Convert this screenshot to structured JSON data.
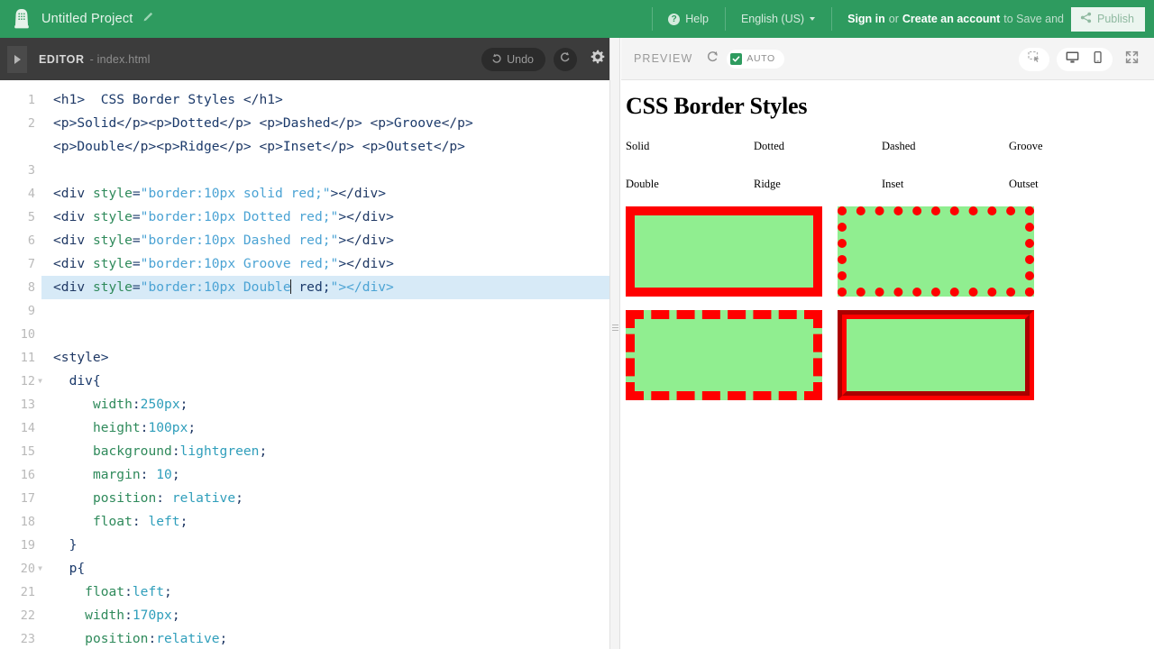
{
  "header": {
    "logo_icon": "thimble-logo-icon",
    "project_title": "Untitled Project",
    "edit_icon": "pencil-icon",
    "help_icon": "question-mark-icon",
    "help_label": "Help",
    "language_label": "English (US)",
    "language_caret": "chevron-down-icon",
    "signin_label": "Sign in",
    "or_label": "or",
    "create_account_label": "Create an account",
    "save_suffix_label": "to Save and",
    "publish_label": "Publish",
    "share_icon": "share-icon",
    "bar_color": "#2e9b5f",
    "publish_bg": "#ebf5ef"
  },
  "editor": {
    "collapse_icon": "triangle-right-icon",
    "title": "EDITOR",
    "filename": "- index.html",
    "undo_label": "Undo",
    "undo_icon": "undo-arrow-icon",
    "redo_icon": "redo-arrow-icon",
    "settings_icon": "gear-icon",
    "toolbar_bg": "#3c3c3c",
    "active_line": 8,
    "lines": [
      {
        "n": "1",
        "fold": false,
        "wrap": false
      },
      {
        "n": "2",
        "fold": false,
        "wrap": true
      },
      {
        "n": "3",
        "fold": false,
        "wrap": false
      },
      {
        "n": "4",
        "fold": false,
        "wrap": false
      },
      {
        "n": "5",
        "fold": false,
        "wrap": false
      },
      {
        "n": "6",
        "fold": false,
        "wrap": false
      },
      {
        "n": "7",
        "fold": false,
        "wrap": false
      },
      {
        "n": "8",
        "fold": false,
        "wrap": false
      },
      {
        "n": "9",
        "fold": false,
        "wrap": false
      },
      {
        "n": "10",
        "fold": false,
        "wrap": false
      },
      {
        "n": "11",
        "fold": false,
        "wrap": false
      },
      {
        "n": "12",
        "fold": true,
        "wrap": false
      },
      {
        "n": "13",
        "fold": false,
        "wrap": false
      },
      {
        "n": "14",
        "fold": false,
        "wrap": false
      },
      {
        "n": "15",
        "fold": false,
        "wrap": false
      },
      {
        "n": "16",
        "fold": false,
        "wrap": false
      },
      {
        "n": "17",
        "fold": false,
        "wrap": false
      },
      {
        "n": "18",
        "fold": false,
        "wrap": false
      },
      {
        "n": "19",
        "fold": false,
        "wrap": false
      },
      {
        "n": "20",
        "fold": true,
        "wrap": false
      },
      {
        "n": "21",
        "fold": false,
        "wrap": false
      },
      {
        "n": "22",
        "fold": false,
        "wrap": false
      },
      {
        "n": "23",
        "fold": false,
        "wrap": false
      }
    ],
    "code": [
      "<h1>  CSS Border Styles </h1>",
      "<p>Solid</p><p>Dotted</p> <p>Dashed</p> <p>Groove</p><p>Double</p><p>Ridge</p> <p>Inset</p> <p>Outset</p>",
      "",
      "<div style=\"border:10px solid red;\"></div>",
      "<div style=\"border:10px Dotted red;\"></div>",
      "<div style=\"border:10px Dashed red;\"></div>",
      "<div style=\"border:10px Groove red;\"></div>",
      "<div style=\"border:10px Double red;\"></div>",
      "",
      "",
      "<style>",
      "  div{",
      "     width:250px;",
      "     height:100px;",
      "     background:lightgreen;",
      "     margin: 10;",
      "     position: relative;",
      "     float: left;",
      "  }",
      "  p{",
      "    float:left;",
      "    width:170px;",
      "    position:relative;"
    ]
  },
  "preview": {
    "title": "PREVIEW",
    "refresh_icon": "refresh-icon",
    "auto_label": "AUTO",
    "auto_checked": true,
    "check_icon": "checkmark-icon",
    "inspector_icon": "inspector-cursor-icon",
    "desktop_icon": "desktop-monitor-icon",
    "mobile_icon": "mobile-phone-icon",
    "fullscreen_icon": "fullscreen-expand-icon",
    "toolbar_bg": "#f4f4f4",
    "accent_green": "#2e9b5f",
    "rendered": {
      "heading": "CSS Border Styles",
      "labels_row1": [
        "Solid",
        "Dotted",
        "Dashed",
        "Groove"
      ],
      "labels_row2": [
        "Double",
        "Ridge",
        "Inset",
        "Outset"
      ],
      "box_fill": "#90ee90",
      "box_border_color": "#ff0000",
      "box_border_width": "10px",
      "boxes": [
        {
          "style": "solid",
          "label": "Solid"
        },
        {
          "style": "dotted",
          "label": "Dotted"
        },
        {
          "style": "dashed",
          "label": "Dashed"
        },
        {
          "style": "groove",
          "label": "Groove"
        }
      ]
    }
  }
}
